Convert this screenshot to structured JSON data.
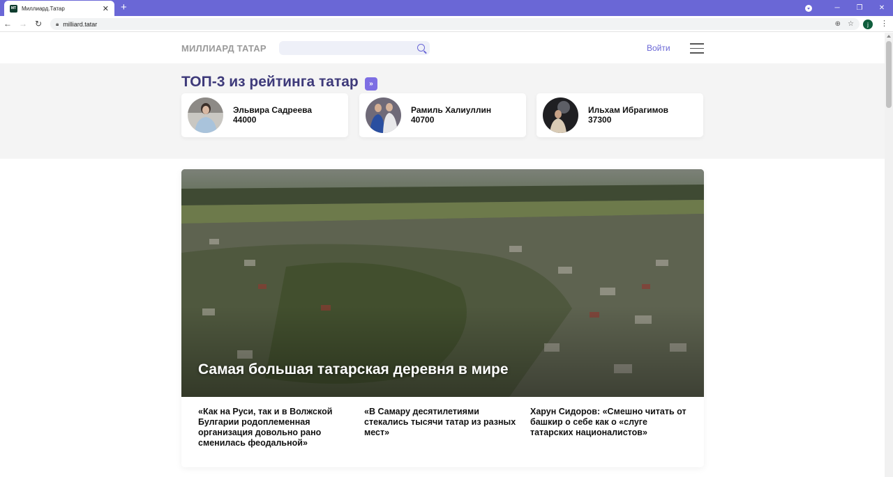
{
  "browser": {
    "tab_title": "Миллиард.Татар",
    "favicon_text": "МТ",
    "url": "milliard.tatar",
    "account_initial": "j"
  },
  "site": {
    "logo": "МИЛЛИАРД ТАТАР",
    "search_placeholder": "",
    "login": "Войти"
  },
  "top": {
    "title": "ТОП-3 из рейтинга татар",
    "more": "»",
    "people": [
      {
        "name": "Эльвира Садреева",
        "score": "44000"
      },
      {
        "name": "Рамиль Халиуллин",
        "score": "40700"
      },
      {
        "name": "Ильхам Ибрагимов",
        "score": "37300"
      }
    ]
  },
  "feature": {
    "title": "Самая большая татарская деревня в мире"
  },
  "news": [
    {
      "title": "«Как на Руси, так и в Волжской Булгарии родоплеменная организация довольно рано сменилась феодальной»"
    },
    {
      "title": "«В Самару десятилетиями стекались тысячи татар из разных мест»"
    },
    {
      "title": "Харун Сидоров: «Смешно читать от башкир о себе как о «слуге татарских националистов»"
    }
  ],
  "colors": {
    "accent": "#6a67d6",
    "title": "#3e3a7a",
    "badge": "#7d6ee3"
  }
}
